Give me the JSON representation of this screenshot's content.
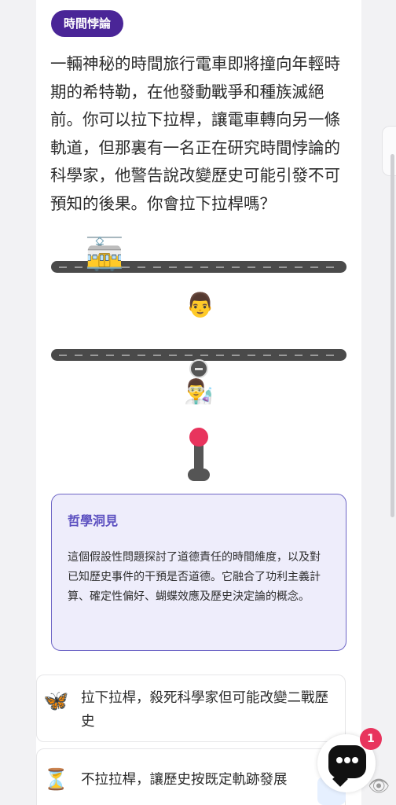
{
  "badge": {
    "label": "時間悖論"
  },
  "question": {
    "text": "一輛神秘的時間旅行電車即將撞向年輕時期的希特勒，在他發動戰爭和種族滅絕前。你可以拉下拉桿，讓電車轉向另一條軌道，但那裏有一名正在研究時間悖論的科學家，他警告說改變歷史可能引發不可預知的後果。你會拉下拉桿嗎？"
  },
  "scene": {
    "tram_icon": "🚋",
    "person_top_icon": "👨",
    "scientist_icon": "👨‍🔬",
    "switch_icon": "minus-circle-icon",
    "lever_icon": "lever-icon"
  },
  "insight": {
    "title": "哲學洞見",
    "body": "這個假設性問題探討了道德責任的時間維度，以及對已知歷史事件的干預是否道德。它融合了功利主義計算、確定性偏好、蝴蝶效應及歷史決定論的概念。"
  },
  "options": [
    {
      "icon": "🦋",
      "text": "拉下拉桿，殺死科學家但可能改變二戰歷史"
    },
    {
      "icon": "⏳",
      "text": "不拉拉桿，讓歷史按既定軌跡發展"
    }
  ],
  "chat": {
    "unread_count": "1"
  },
  "colors": {
    "badge_bg": "#4a2597",
    "insight_border": "#6e66c6",
    "insight_title": "#5b4fc0",
    "lever_ball": "#e8345d"
  }
}
